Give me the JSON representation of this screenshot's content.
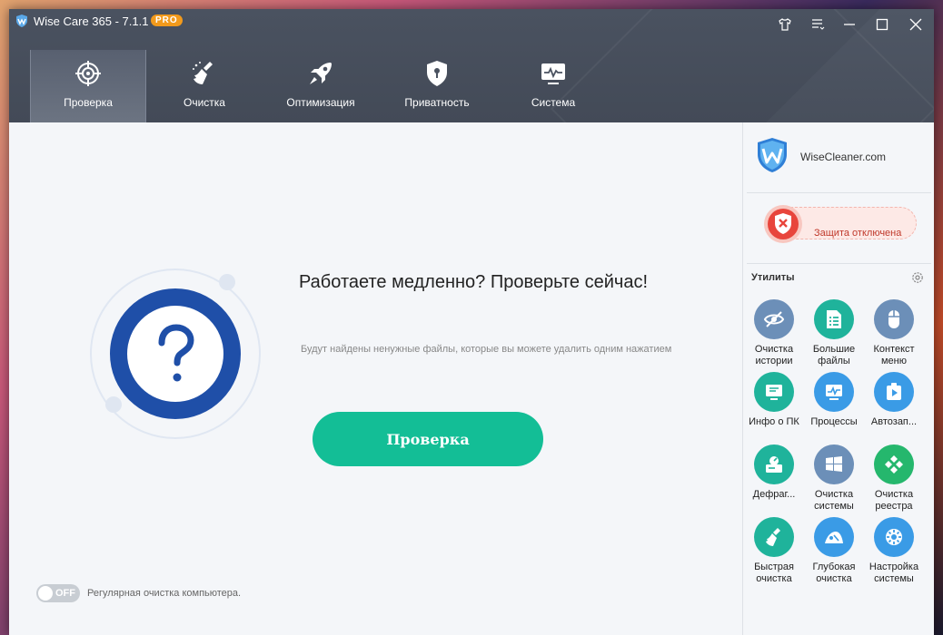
{
  "app": {
    "title": "Wise Care 365 - 7.1.1",
    "badge": "PRO"
  },
  "nav": [
    {
      "label": "Проверка",
      "icon": "target-icon",
      "active": true
    },
    {
      "label": "Очистка",
      "icon": "broom-icon"
    },
    {
      "label": "Оптимизация",
      "icon": "rocket-icon"
    },
    {
      "label": "Приватность",
      "icon": "shield-lock-icon"
    },
    {
      "label": "Система",
      "icon": "monitor-icon"
    }
  ],
  "main": {
    "headline": "Работаете медленно? Проверьте сейчас!",
    "subtext": "Будут найдены ненужные файлы, которые вы можете удалить одним нажатием",
    "scan_button": "Проверка",
    "toggle_state": "OFF",
    "toggle_caption": "Регулярная очистка компьютера."
  },
  "side": {
    "brand": "WiseCleaner.com",
    "protection": "Защита отключена",
    "utilities_title": "Утилиты",
    "tools": [
      {
        "label": "Очистка\nистории",
        "icon": "eye-off-icon",
        "color": "#6c8fb8"
      },
      {
        "label": "Большие\nфайлы",
        "icon": "file-list-icon",
        "color": "#1fb39b"
      },
      {
        "label": "Контекст\nменю",
        "icon": "mouse-icon",
        "color": "#6c8fb8"
      },
      {
        "label": "Инфо о ПК",
        "icon": "pc-info-icon",
        "color": "#1fb39b"
      },
      {
        "label": "Процессы",
        "icon": "chart-monitor-icon",
        "color": "#3a9be6"
      },
      {
        "label": "Автозап...",
        "icon": "startup-icon",
        "color": "#3a9be6"
      },
      {
        "label": "Дефраг...",
        "icon": "defrag-icon",
        "color": "#1fb39b"
      },
      {
        "label": "Очистка\nсистемы",
        "icon": "windows-icon",
        "color": "#6c8fb8"
      },
      {
        "label": "Очистка\nреестра",
        "icon": "registry-icon",
        "color": "#25b76d"
      },
      {
        "label": "Быстрая\nочистка",
        "icon": "quick-clean-icon",
        "color": "#1fb39b"
      },
      {
        "label": "Глубокая\nочистка",
        "icon": "deep-clean-icon",
        "color": "#3a9be6"
      },
      {
        "label": "Настройка\nсистемы",
        "icon": "tune-icon",
        "color": "#3a9be6"
      }
    ]
  }
}
